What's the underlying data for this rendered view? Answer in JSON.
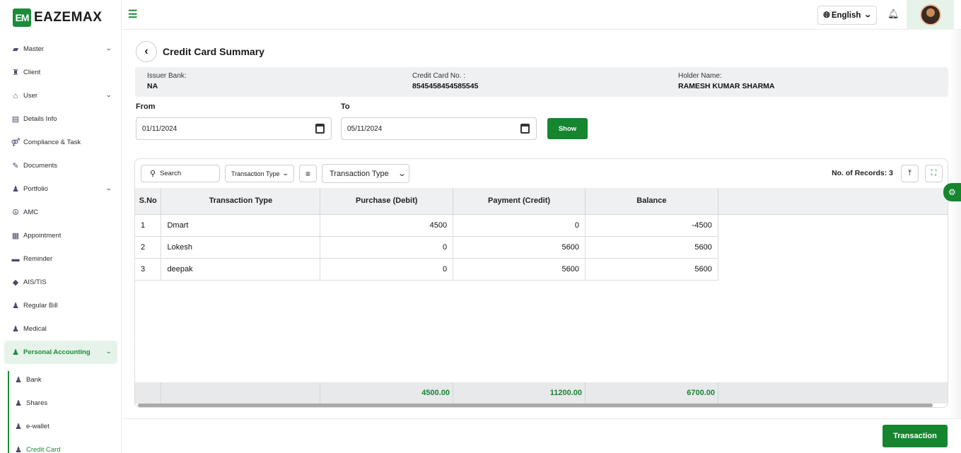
{
  "brand": {
    "logo_mark": "EM",
    "name": "EAZEMAX"
  },
  "sidebar": {
    "items": [
      {
        "label": "Master",
        "icon": "folder-icon",
        "glyph": "▰",
        "has_chevron": true
      },
      {
        "label": "Client",
        "icon": "client-icon",
        "glyph": "♜",
        "has_chevron": false
      },
      {
        "label": "User",
        "icon": "user-icon",
        "glyph": "⌂",
        "has_chevron": true
      },
      {
        "label": "Details Info",
        "icon": "details-icon",
        "glyph": "▤",
        "has_chevron": false
      },
      {
        "label": "Compliance & Task",
        "icon": "compliance-icon",
        "glyph": "⚤",
        "has_chevron": false
      },
      {
        "label": "Documents",
        "icon": "documents-icon",
        "glyph": "✎",
        "has_chevron": false
      },
      {
        "label": "Portfolio",
        "icon": "portfolio-icon",
        "glyph": "♟",
        "has_chevron": true
      },
      {
        "label": "AMC",
        "icon": "amc-icon",
        "glyph": "☮",
        "has_chevron": false
      },
      {
        "label": "Appointment",
        "icon": "appointment-icon",
        "glyph": "▦",
        "has_chevron": false
      },
      {
        "label": "Reminder",
        "icon": "reminder-icon",
        "glyph": "▬",
        "has_chevron": false
      },
      {
        "label": "AIS/TIS",
        "icon": "tag-icon",
        "glyph": "◆",
        "has_chevron": false
      },
      {
        "label": "Regular Bill",
        "icon": "user-check-icon",
        "glyph": "♟",
        "has_chevron": false
      },
      {
        "label": "Medical",
        "icon": "user-check-icon",
        "glyph": "♟",
        "has_chevron": false
      }
    ],
    "active": {
      "label": "Personal Accounting",
      "icon": "user-check-icon",
      "glyph": "♟"
    },
    "sub_items": [
      {
        "label": "Bank",
        "glyph": "♟"
      },
      {
        "label": "Shares",
        "glyph": "♟"
      },
      {
        "label": "e-wallet",
        "glyph": "♟"
      },
      {
        "label": "Credit Card",
        "glyph": "♟"
      }
    ]
  },
  "topbar": {
    "language": "English"
  },
  "page": {
    "title": "Credit Card Summary",
    "issuer_label": "Issuer Bank:",
    "issuer_value": "NA",
    "card_label": "Credit Card No. :",
    "card_value": "8545458454585545",
    "holder_label": "Holder Name:",
    "holder_value": "RAMESH KUMAR SHARMA",
    "from_label": "From",
    "from_value": "01/11/2024",
    "to_label": "To",
    "to_value": "05/11/2024",
    "show_label": "Show",
    "transaction_label": "Transaction"
  },
  "table": {
    "search_placeholder": "Search",
    "filter1_label": "Transaction Type",
    "filter2_label": "Transaction Type",
    "records_text": "No. of Records: 3",
    "columns": [
      "S.No",
      "Transaction Type",
      "Purchase (Debit)",
      "Payment (Credit)",
      "Balance"
    ],
    "rows": [
      {
        "sno": "1",
        "type": "Dmart",
        "debit": "4500",
        "credit": "0",
        "balance": "-4500"
      },
      {
        "sno": "2",
        "type": "Lokesh",
        "debit": "0",
        "credit": "5600",
        "balance": "5600"
      },
      {
        "sno": "3",
        "type": "deepak",
        "debit": "0",
        "credit": "5600",
        "balance": "5600"
      }
    ],
    "totals": {
      "debit": "4500.00",
      "credit": "11200.00",
      "balance": "6700.00"
    }
  },
  "colors": {
    "accent": "#15862f",
    "active_bg": "#e6f3ea",
    "strip_bg": "#eff0f2"
  }
}
